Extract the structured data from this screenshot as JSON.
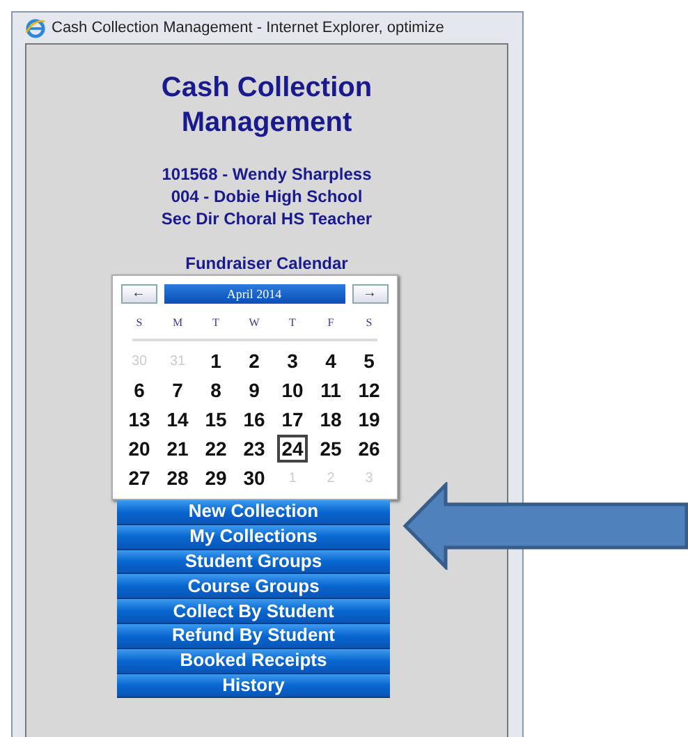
{
  "window": {
    "title": "Cash Collection Management - Internet Explorer, optimize"
  },
  "app_title": "Cash Collection Management",
  "user_info": [
    "101568 - Wendy Sharpless",
    "004 - Dobie High School",
    "Sec Dir Choral HS Teacher"
  ],
  "calendar": {
    "heading": "Fundraiser Calendar",
    "prev": "←",
    "month": "April 2014",
    "next": "→",
    "weekdays": [
      "S",
      "M",
      "T",
      "W",
      "T",
      "F",
      "S"
    ],
    "weeks": [
      [
        {
          "day": "30",
          "outside": true,
          "selected": false
        },
        {
          "day": "31",
          "outside": true,
          "selected": false
        },
        {
          "day": "1",
          "outside": false,
          "selected": false
        },
        {
          "day": "2",
          "outside": false,
          "selected": false
        },
        {
          "day": "3",
          "outside": false,
          "selected": false
        },
        {
          "day": "4",
          "outside": false,
          "selected": false
        },
        {
          "day": "5",
          "outside": false,
          "selected": false
        }
      ],
      [
        {
          "day": "6",
          "outside": false,
          "selected": false
        },
        {
          "day": "7",
          "outside": false,
          "selected": false
        },
        {
          "day": "8",
          "outside": false,
          "selected": false
        },
        {
          "day": "9",
          "outside": false,
          "selected": false
        },
        {
          "day": "10",
          "outside": false,
          "selected": false
        },
        {
          "day": "11",
          "outside": false,
          "selected": false
        },
        {
          "day": "12",
          "outside": false,
          "selected": false
        }
      ],
      [
        {
          "day": "13",
          "outside": false,
          "selected": false
        },
        {
          "day": "14",
          "outside": false,
          "selected": false
        },
        {
          "day": "15",
          "outside": false,
          "selected": false
        },
        {
          "day": "16",
          "outside": false,
          "selected": false
        },
        {
          "day": "17",
          "outside": false,
          "selected": false
        },
        {
          "day": "18",
          "outside": false,
          "selected": false
        },
        {
          "day": "19",
          "outside": false,
          "selected": false
        }
      ],
      [
        {
          "day": "20",
          "outside": false,
          "selected": false
        },
        {
          "day": "21",
          "outside": false,
          "selected": false
        },
        {
          "day": "22",
          "outside": false,
          "selected": false
        },
        {
          "day": "23",
          "outside": false,
          "selected": false
        },
        {
          "day": "24",
          "outside": false,
          "selected": true
        },
        {
          "day": "25",
          "outside": false,
          "selected": false
        },
        {
          "day": "26",
          "outside": false,
          "selected": false
        }
      ],
      [
        {
          "day": "27",
          "outside": false,
          "selected": false
        },
        {
          "day": "28",
          "outside": false,
          "selected": false
        },
        {
          "day": "29",
          "outside": false,
          "selected": false
        },
        {
          "day": "30",
          "outside": false,
          "selected": false
        },
        {
          "day": "1",
          "outside": true,
          "selected": false
        },
        {
          "day": "2",
          "outside": true,
          "selected": false
        },
        {
          "day": "3",
          "outside": true,
          "selected": false
        }
      ]
    ]
  },
  "menu": [
    "New Collection",
    "My Collections",
    "Student Groups",
    "Course Groups",
    "Collect By Student",
    "Refund By Student",
    "Booked Receipts",
    "History"
  ]
}
